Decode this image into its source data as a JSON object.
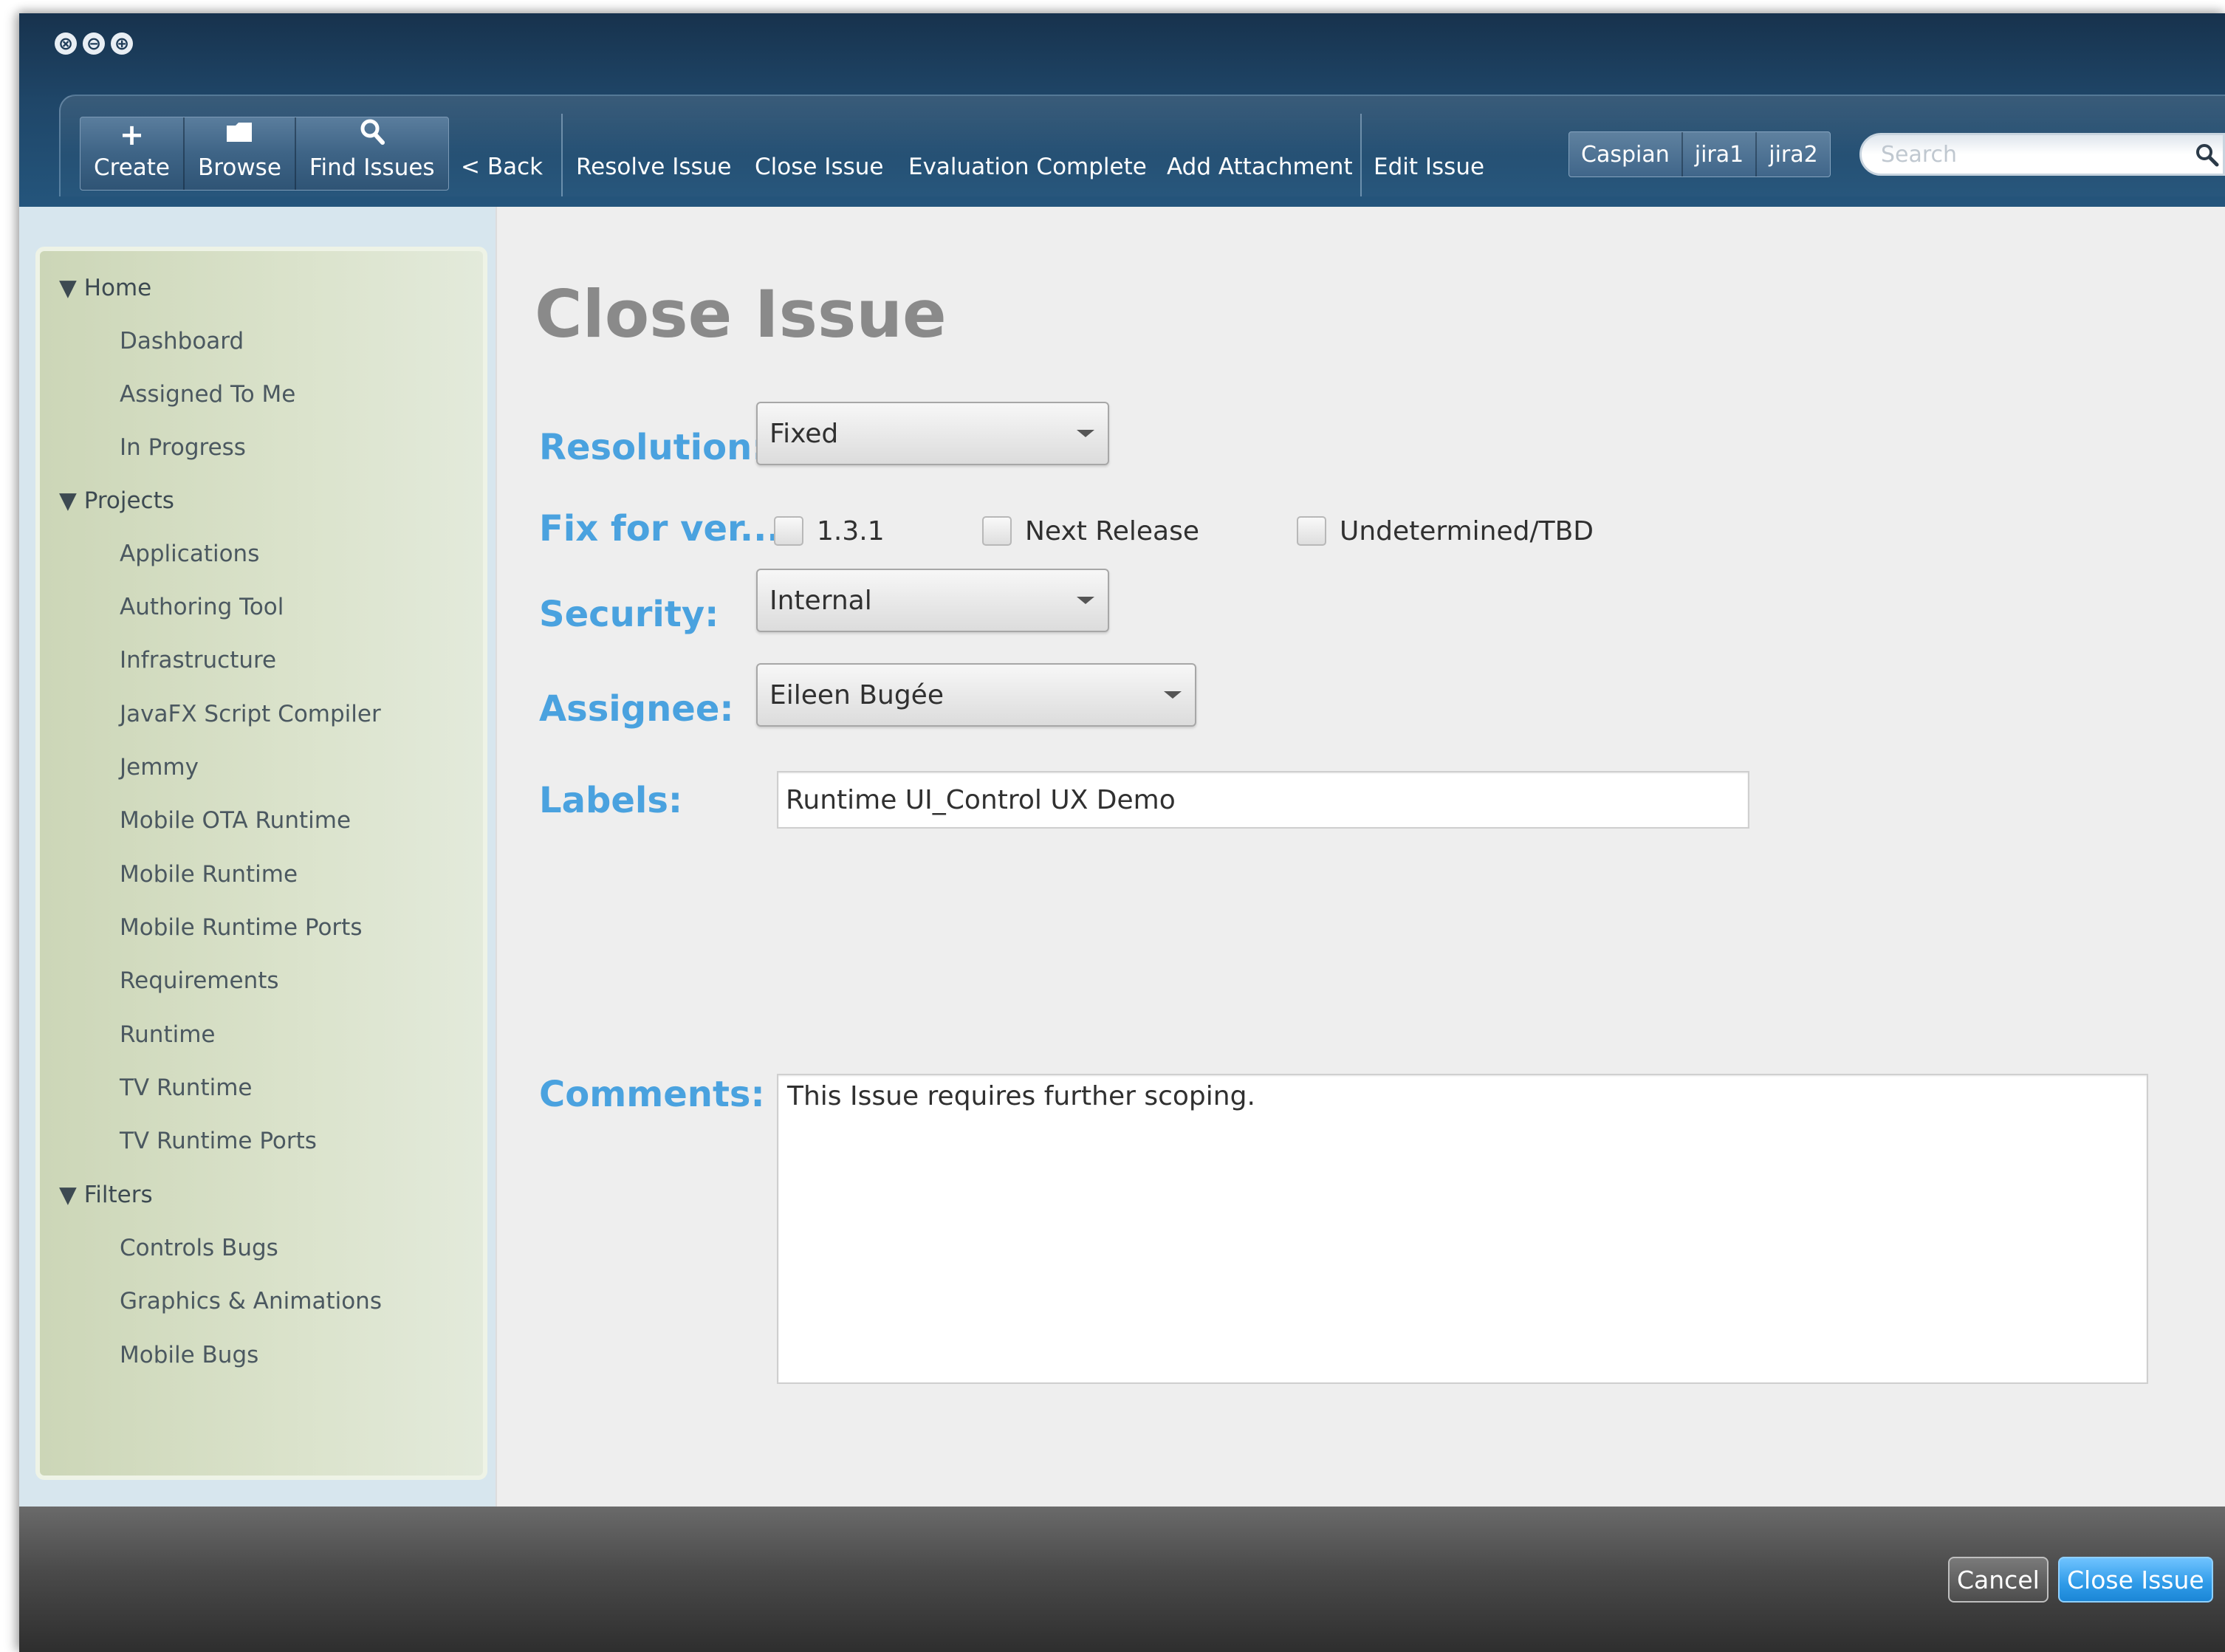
{
  "window_controls": [
    "⊗",
    "⊖",
    "⊕"
  ],
  "toolbar": {
    "primary": [
      {
        "label": "Create",
        "icon": "plus-icon",
        "glyph": "+"
      },
      {
        "label": "Browse",
        "icon": "folder-icon",
        "glyph": "▬"
      },
      {
        "label": "Find Issues",
        "icon": "search-icon",
        "glyph": "⚲"
      }
    ],
    "back_label": "< Back",
    "actions": [
      "Resolve Issue",
      "Close Issue",
      "Evaluation Complete",
      "Add Attachment"
    ],
    "edit_label": "Edit Issue",
    "users": [
      "Caspian",
      "jira1",
      "jira2"
    ],
    "search_placeholder": "Search"
  },
  "sidebar": {
    "sections": [
      {
        "title": "▼ Home",
        "items": [
          "Dashboard",
          "Assigned To Me",
          "In Progress"
        ]
      },
      {
        "title": "▼ Projects",
        "items": [
          "Applications",
          "Authoring Tool",
          "Infrastructure",
          "JavaFX Script Compiler",
          "Jemmy",
          "Mobile OTA Runtime",
          "Mobile Runtime",
          "Mobile Runtime Ports",
          "Requirements",
          "Runtime",
          "TV Runtime",
          "TV Runtime Ports"
        ]
      },
      {
        "title": "▼ Filters",
        "items": [
          "Controls Bugs",
          "Graphics & Animations",
          "Mobile Bugs"
        ]
      }
    ]
  },
  "form": {
    "title": "Close Issue",
    "resolution": {
      "label": "Resolution:",
      "value": "Fixed"
    },
    "fix_for": {
      "label": "Fix for ver...",
      "options": [
        "1.3.1",
        "Next Release",
        "Undetermined/TBD"
      ]
    },
    "security": {
      "label": "Security:",
      "value": "Internal"
    },
    "assignee": {
      "label": "Assignee:",
      "value": "Eileen Bugée"
    },
    "labels": {
      "label": "Labels:",
      "value": "Runtime UI_Control UX Demo"
    },
    "comments": {
      "label": "Comments:",
      "value": "This Issue requires further scoping."
    }
  },
  "footer": {
    "cancel_label": "Cancel",
    "submit_label": "Close Issue"
  },
  "colors": {
    "field_label": "#4aa2df",
    "toolbar_bg": "#1f4668",
    "sidebar_bg": "#d3ddc2",
    "primary_button": "#2f9be8"
  }
}
